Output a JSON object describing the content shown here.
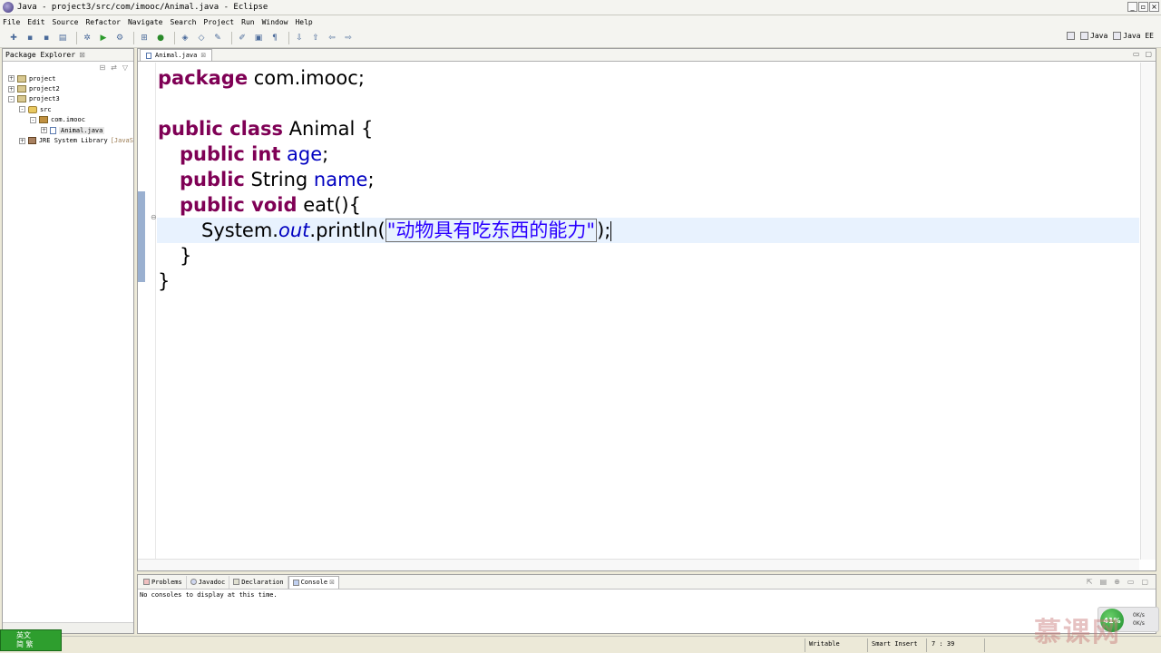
{
  "window": {
    "title": "Java - project3/src/com/imooc/Animal.java - Eclipse",
    "buttons": {
      "minimize": "_",
      "restore": "▫",
      "close": "×"
    }
  },
  "menu": [
    "File",
    "Edit",
    "Source",
    "Refactor",
    "Navigate",
    "Search",
    "Project",
    "Run",
    "Window",
    "Help"
  ],
  "perspectives": {
    "java": "Java",
    "java_ee": "Java EE"
  },
  "package_explorer": {
    "tab_label": "Package Explorer",
    "tree": [
      {
        "label": "project",
        "indent": 0,
        "icon": "project-icon",
        "expander": "+"
      },
      {
        "label": "project2",
        "indent": 0,
        "icon": "project-icon",
        "expander": "+"
      },
      {
        "label": "project3",
        "indent": 0,
        "icon": "project-icon",
        "expander": "-"
      },
      {
        "label": "src",
        "indent": 1,
        "icon": "source-folder-icon",
        "expander": "-"
      },
      {
        "label": "com.imooc",
        "indent": 2,
        "icon": "package-icon",
        "expander": "-"
      },
      {
        "label": "Animal.java",
        "indent": 3,
        "icon": "java-file-icon",
        "expander": "+",
        "selected": true
      },
      {
        "label": "JRE System Library",
        "dim": "[JavaS",
        "indent": 1,
        "icon": "jre-library-icon",
        "expander": "+"
      }
    ]
  },
  "editor": {
    "tab_label": "Animal.java",
    "code": {
      "l1_kw": "package",
      "l1_rest": " com.imooc;",
      "l3_kw": "public class",
      "l3_rest": " Animal {",
      "l4_kw": "public int",
      "l4_field": "age",
      "l4_end": ";",
      "l5_kw": "public",
      "l5_type": " String ",
      "l5_field": "name",
      "l5_end": ";",
      "l6_kw": "public void",
      "l6_rest": " eat(){",
      "l7_sys": "System.",
      "l7_out": "out",
      "l7_call": ".println(",
      "l7_str": "\"动物具有吃东西的能力\"",
      "l7_end": ");",
      "l8": "}",
      "l9": "}"
    }
  },
  "bottom_tabs": [
    {
      "label": "Problems",
      "active": false
    },
    {
      "label": "Javadoc",
      "active": false
    },
    {
      "label": "Declaration",
      "active": false
    },
    {
      "label": "Console",
      "active": true
    }
  ],
  "console_message": "No consoles to display at this time.",
  "status": {
    "writable": "Writable",
    "insert_mode": "Smart Insert",
    "position": "7 : 39"
  },
  "ime": {
    "line1": "英文",
    "line2": "简 繁"
  },
  "net_widget": {
    "percent": "41%",
    "up": "0K/s",
    "down": "0K/s"
  },
  "watermark": "慕课网"
}
